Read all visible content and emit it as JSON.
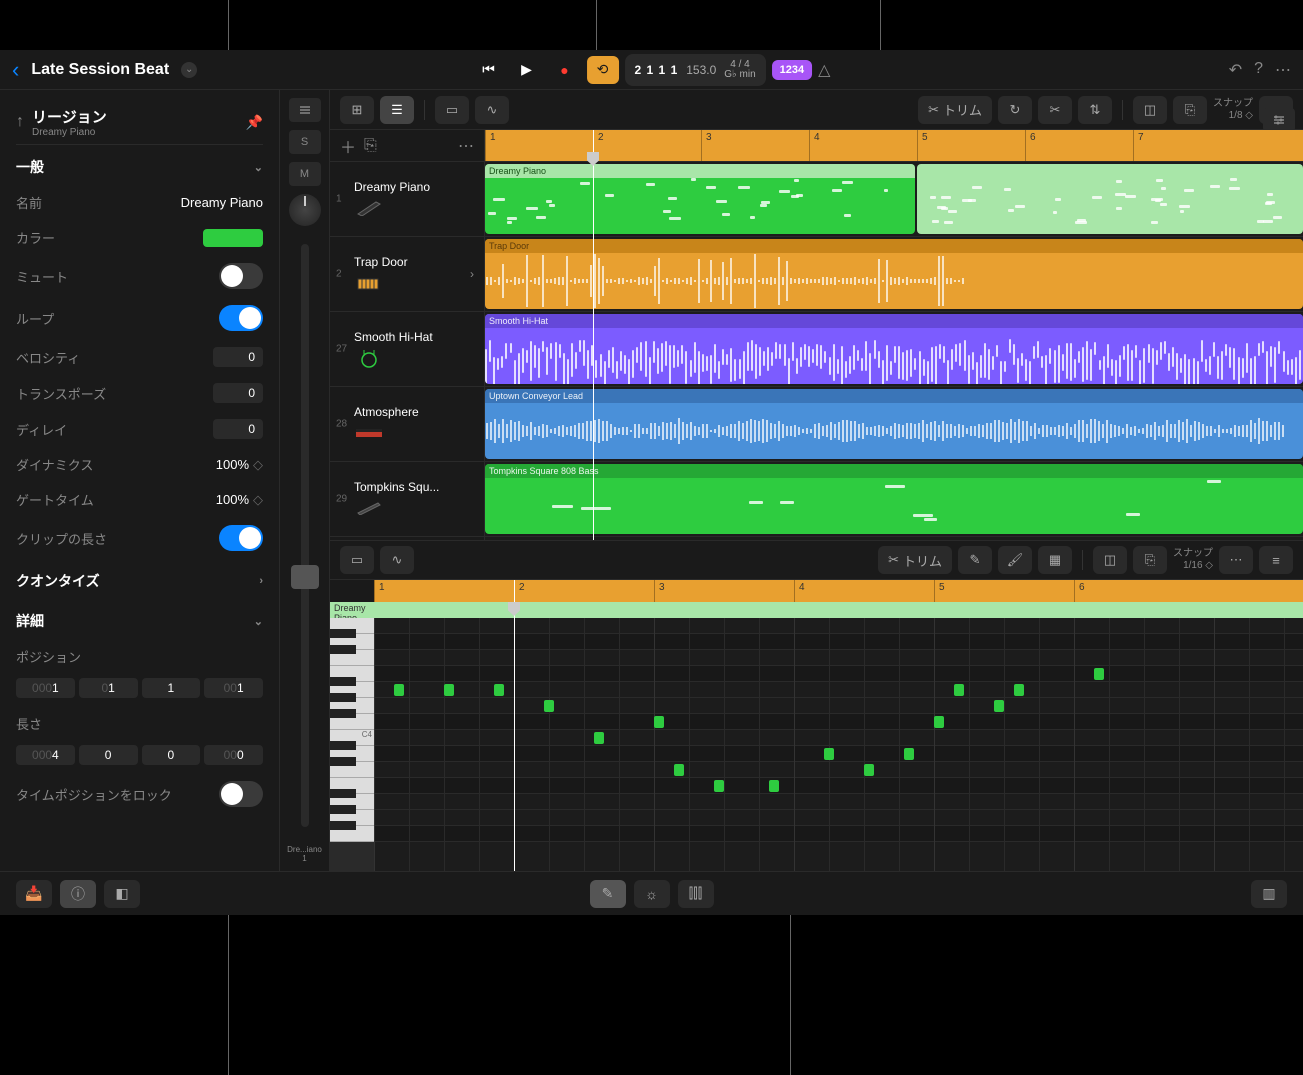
{
  "project": {
    "title": "Late Session Beat"
  },
  "transport": {
    "position": "2 1 1   1",
    "tempo": "153.0",
    "sig_top": "4 / 4",
    "sig_bot": "G♭ min",
    "mode": "1234"
  },
  "inspector": {
    "title": "リージョン",
    "subtitle": "Dreamy Piano",
    "sections": {
      "general": "一般",
      "quantize": "クオンタイズ",
      "details": "詳細"
    },
    "props": {
      "name_label": "名前",
      "name_value": "Dreamy Piano",
      "color_label": "カラー",
      "mute_label": "ミュート",
      "loop_label": "ループ",
      "velocity_label": "ベロシティ",
      "velocity_value": "0",
      "transpose_label": "トランスポーズ",
      "transpose_value": "0",
      "delay_label": "ディレイ",
      "delay_value": "0",
      "dynamics_label": "ダイナミクス",
      "dynamics_value": "100%",
      "gatetime_label": "ゲートタイム",
      "gatetime_value": "100%",
      "cliplength_label": "クリップの長さ",
      "position_label": "ポジション",
      "length_label": "長さ",
      "lock_label": "タイムポジションをロック"
    },
    "position": [
      "0001",
      "01",
      "1",
      "001"
    ],
    "length": [
      "0004",
      "0",
      "0",
      "000"
    ]
  },
  "mixer_strip": {
    "solo": "S",
    "mute": "M",
    "label": "Dre...iano",
    "label2": "1"
  },
  "tracks_toolbar": {
    "trim": "トリム",
    "snap_label": "スナップ",
    "snap_value": "1/8"
  },
  "editor_toolbar": {
    "trim": "トリム",
    "snap_label": "スナップ",
    "snap_value": "1/16"
  },
  "ruler_marks": [
    "1",
    "2",
    "3",
    "4",
    "5",
    "6",
    "7"
  ],
  "tracks": [
    {
      "num": "1",
      "name": "Dreamy Piano",
      "region": "Dreamy Piano",
      "color": "green"
    },
    {
      "num": "2",
      "name": "Trap Door",
      "region": "Trap Door",
      "color": "yellow"
    },
    {
      "num": "27",
      "name": "Smooth Hi-Hat",
      "region": "Smooth Hi-Hat",
      "color": "purple"
    },
    {
      "num": "28",
      "name": "Atmosphere",
      "region": "Uptown Conveyor Lead",
      "color": "blue"
    },
    {
      "num": "29",
      "name": "Tompkins Squ...",
      "region": "Tompkins Square 808 Bass",
      "color": "green"
    }
  ],
  "piano_roll": {
    "header": "Dreamy Piano",
    "key_label": "C4",
    "ruler_marks": [
      "1",
      "2",
      "3",
      "4",
      "5",
      "6"
    ]
  }
}
